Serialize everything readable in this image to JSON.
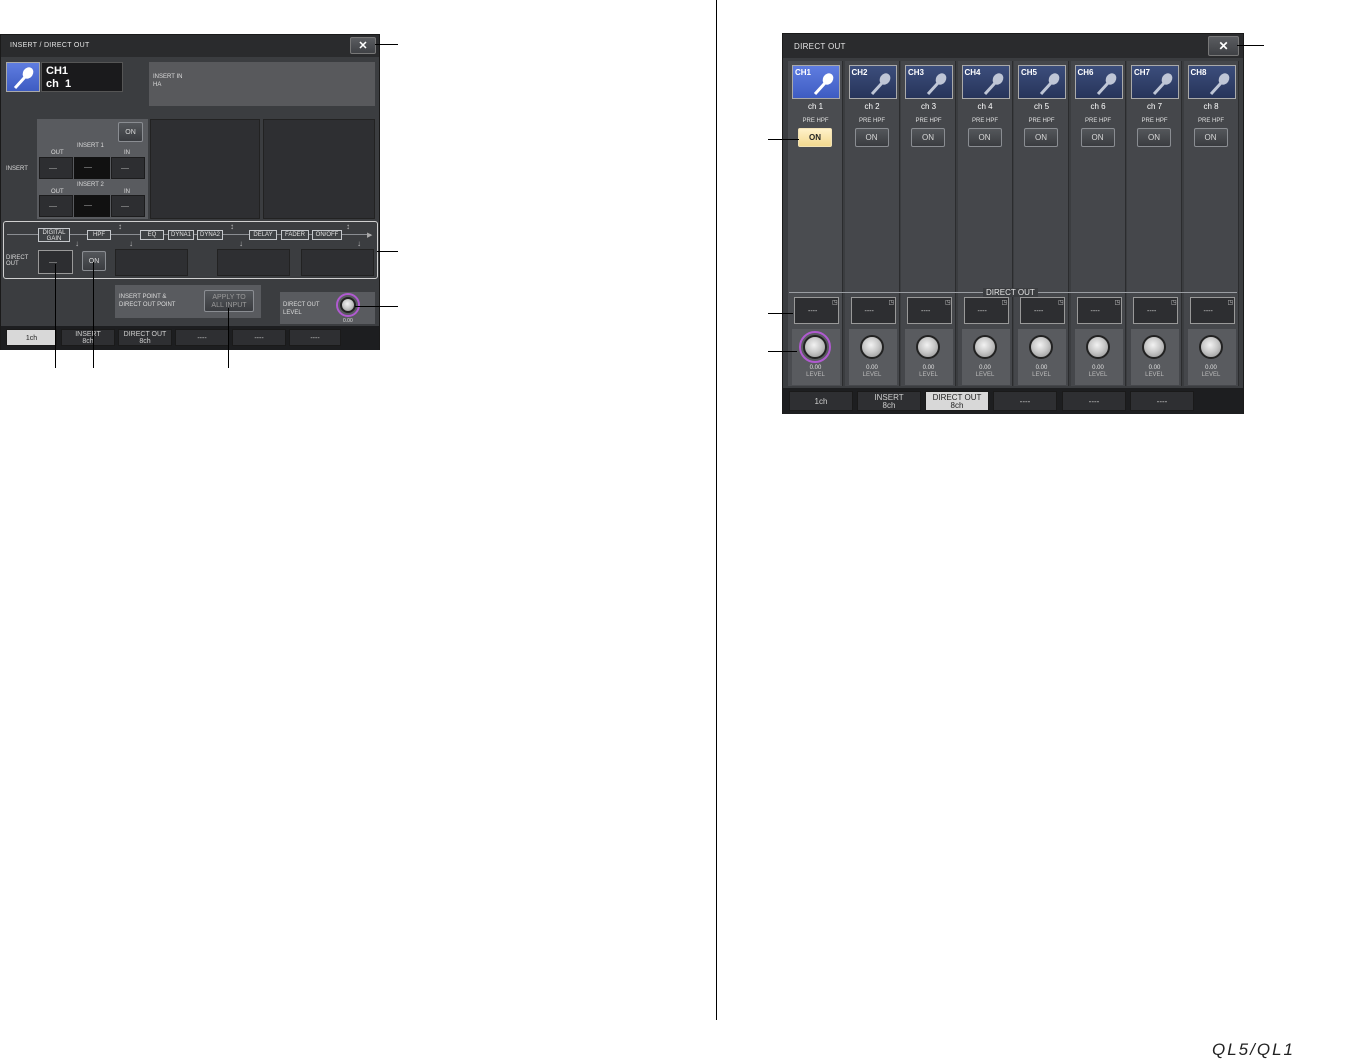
{
  "left": {
    "title": "INSERT / DIRECT OUT",
    "close_label": "✕",
    "channel": {
      "name": "CH1",
      "label": "ch  1"
    },
    "insert_in": {
      "line1": "INSERT IN",
      "line2": "HA"
    },
    "insert": {
      "section_label": "INSERT",
      "on_label": "ON",
      "insert1": {
        "label": "INSERT 1",
        "out": "OUT",
        "in": "IN",
        "out_value": "----",
        "mid_value": "----",
        "in_value": "----"
      },
      "insert2": {
        "label": "INSERT 2",
        "out": "OUT",
        "in": "IN",
        "out_value": "----",
        "mid_value": "----",
        "in_value": "----"
      }
    },
    "flow": [
      "DIGITAL GAIN",
      "HPF",
      "EQ",
      "DYNA1",
      "DYNA2",
      "DELAY",
      "FADER",
      "ON/OFF"
    ],
    "direct_out": {
      "label1": "DIRECT",
      "label2": "OUT",
      "port_value": "----",
      "on_label": "ON"
    },
    "point_label1": "INSERT POINT &",
    "point_label2": "DIRECT OUT POINT",
    "apply_label1": "APPLY TO",
    "apply_label2": "ALL INPUT",
    "level_label1": "DIRECT OUT",
    "level_label2": "LEVEL",
    "level_value": "0.00",
    "tabs": [
      {
        "line1": "1ch",
        "line2": ""
      },
      {
        "line1": "INSERT",
        "line2": "8ch"
      },
      {
        "line1": "DIRECT OUT",
        "line2": "8ch"
      },
      {
        "line1": "----",
        "line2": ""
      },
      {
        "line1": "----",
        "line2": ""
      },
      {
        "line1": "----",
        "line2": ""
      }
    ]
  },
  "right": {
    "title": "DIRECT OUT",
    "close_label": "✕",
    "section_label": "DIRECT OUT",
    "pre_hpf_label": "PRE HPF",
    "on_label": "ON",
    "port_value": "----",
    "level_value": "0.00",
    "level_label": "LEVEL",
    "channels": [
      {
        "id": "CH1",
        "name": "ch 1"
      },
      {
        "id": "CH2",
        "name": "ch 2"
      },
      {
        "id": "CH3",
        "name": "ch 3"
      },
      {
        "id": "CH4",
        "name": "ch 4"
      },
      {
        "id": "CH5",
        "name": "ch 5"
      },
      {
        "id": "CH6",
        "name": "ch 6"
      },
      {
        "id": "CH7",
        "name": "ch 7"
      },
      {
        "id": "CH8",
        "name": "ch 8"
      }
    ],
    "tabs": [
      {
        "line1": "1ch",
        "line2": ""
      },
      {
        "line1": "INSERT",
        "line2": "8ch"
      },
      {
        "line1": "DIRECT OUT",
        "line2": "8ch"
      },
      {
        "line1": "----",
        "line2": ""
      },
      {
        "line1": "----",
        "line2": ""
      },
      {
        "line1": "----",
        "line2": ""
      }
    ]
  },
  "footer": {
    "logo": "QL5/QL1"
  }
}
